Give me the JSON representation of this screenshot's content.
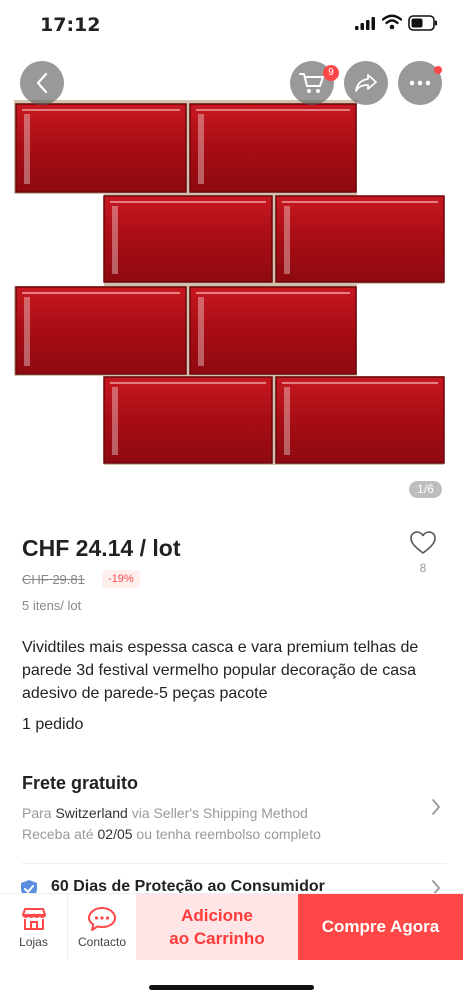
{
  "status_bar": {
    "time": "17:12"
  },
  "header": {
    "cart_count": "9"
  },
  "gallery": {
    "pager": "1/6"
  },
  "product": {
    "price": "CHF 24.14 / lot",
    "old_price": "CHF 29.81",
    "discount": "-19%",
    "units": "5 itens/ lot",
    "wishlist_count": "8",
    "title": "Vividtiles mais espessa casca e vara premium telhas de parede 3d festival vermelho popular decoração de casa adesivo de parede-5 peças pacote",
    "orders": "1 pedido"
  },
  "shipping": {
    "title": "Frete gratuito",
    "line1_prefix": "Para ",
    "country": "Switzerland",
    "line1_suffix": " via Seller's Shipping Method",
    "line2_prefix": "Receba até ",
    "date": "02/05",
    "line2_suffix": " ou tenha reembolso completo"
  },
  "protection": {
    "title": "60 Dias de Proteção ao Consumidor"
  },
  "bottom_bar": {
    "stores": "Lojas",
    "contact": "Contacto",
    "add_cart_line1": "Adicione",
    "add_cart_line2": "ao Carrinho",
    "buy_now": "Compre Agora"
  },
  "colors": {
    "accent": "#ff4747",
    "tile": "#b30d16",
    "add_cart_bg": "#ffe5e5"
  }
}
